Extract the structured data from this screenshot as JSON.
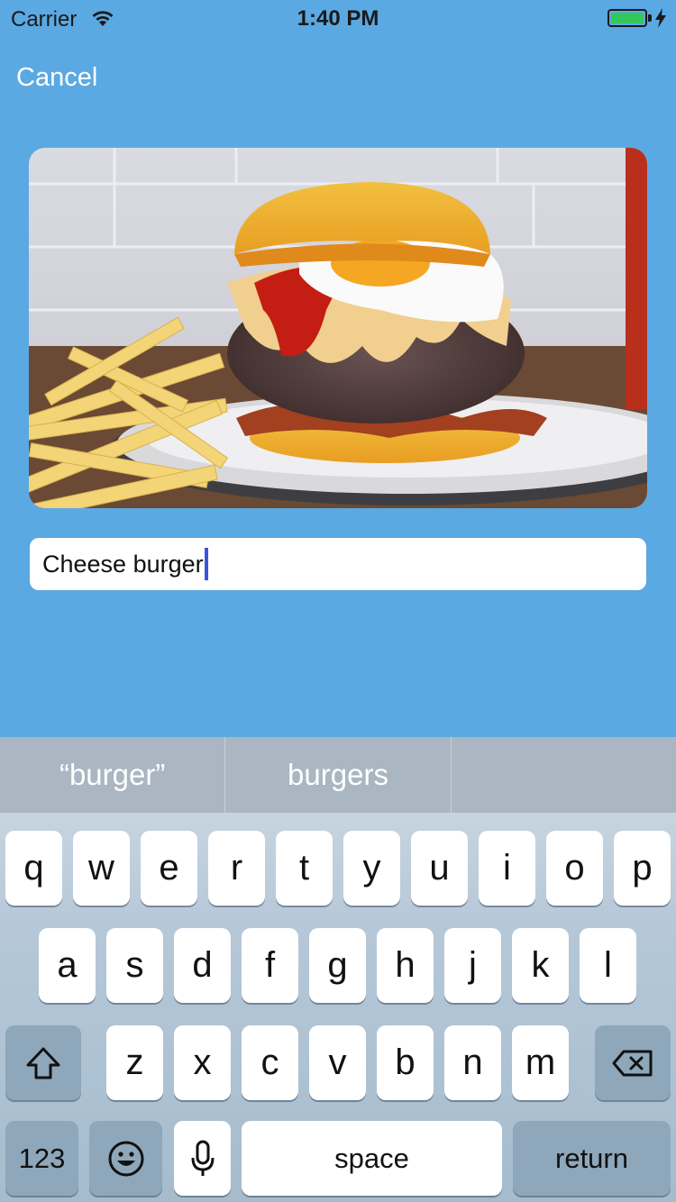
{
  "status_bar": {
    "carrier": "Carrier",
    "time": "1:40 PM",
    "battery_level": 1.0
  },
  "nav": {
    "cancel_label": "Cancel"
  },
  "photo": {
    "alt": "Cheese burger with fried egg and fries"
  },
  "name_field": {
    "value": "Cheese burger"
  },
  "keyboard": {
    "suggestions": [
      "“burger”",
      "burgers",
      ""
    ],
    "row1": [
      "q",
      "w",
      "e",
      "r",
      "t",
      "y",
      "u",
      "i",
      "o",
      "p"
    ],
    "row2": [
      "a",
      "s",
      "d",
      "f",
      "g",
      "h",
      "j",
      "k",
      "l"
    ],
    "row3": [
      "z",
      "x",
      "c",
      "v",
      "b",
      "n",
      "m"
    ],
    "numbers_label": "123",
    "space_label": "space",
    "return_label": "return"
  },
  "colors": {
    "background": "#5ba9e3",
    "caret": "#3b55d9",
    "battery": "#34c759"
  }
}
